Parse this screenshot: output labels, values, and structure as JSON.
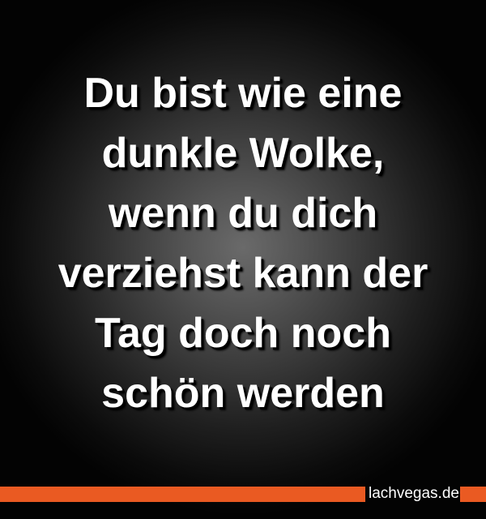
{
  "quote": {
    "lines": [
      "Du bist wie eine",
      "dunkle Wolke,",
      "wenn du dich",
      "verziehst kann der",
      "Tag doch noch",
      "schön werden"
    ]
  },
  "footer": {
    "brand": "lachvegas.de"
  },
  "colors": {
    "accent_bar": "#ea5a22",
    "text": "#ffffff",
    "background": "#000000"
  }
}
